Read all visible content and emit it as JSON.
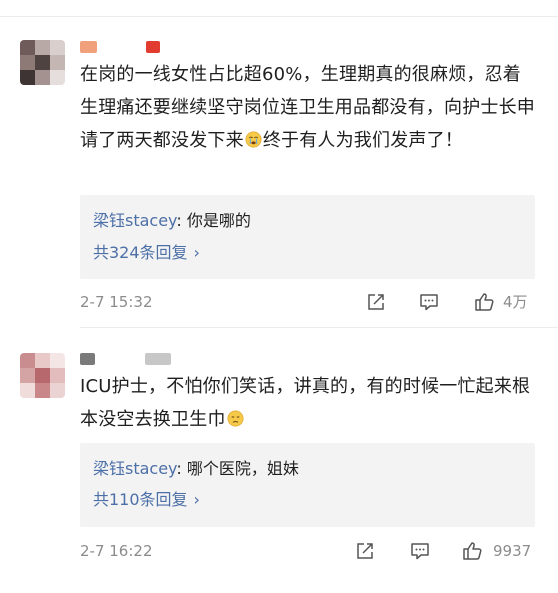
{
  "comments": [
    {
      "text_before_emoji": "在岗的一线女性占比超60%，生理期真的很麻烦，忍着生理痛还要继续坚守岗位连卫生用品都没有，向护士长申请了两天都没发下来",
      "text_after_emoji": "终于有人为我们发声了！",
      "emoji_icon": "crying-face-icon",
      "reply": {
        "author": "梁钰stacey",
        "separator": ": ",
        "text": "你是哪的",
        "count_label": "共324条回复",
        "chevron": "›"
      },
      "timestamp": "2-7 15:32",
      "likes": "4万"
    },
    {
      "text_before_emoji": "ICU护士，不怕你们笑话，讲真的，有的时候一忙起来根本没空去换卫生巾",
      "text_after_emoji": "",
      "emoji_icon": "sad-face-icon",
      "reply": {
        "author": "梁钰stacey",
        "separator": ": ",
        "text": "哪个医院，姐妹",
        "count_label": "共110条回复",
        "chevron": "›"
      },
      "timestamp": "2-7 16:22",
      "likes": "9937"
    }
  ],
  "icons": {
    "share": "share-icon",
    "comment": "comment-icon",
    "like": "thumbs-up-icon"
  },
  "colors": {
    "link": "#4c6fa7",
    "meta": "#8c8c8c",
    "reply_bg": "#f3f3f3"
  }
}
